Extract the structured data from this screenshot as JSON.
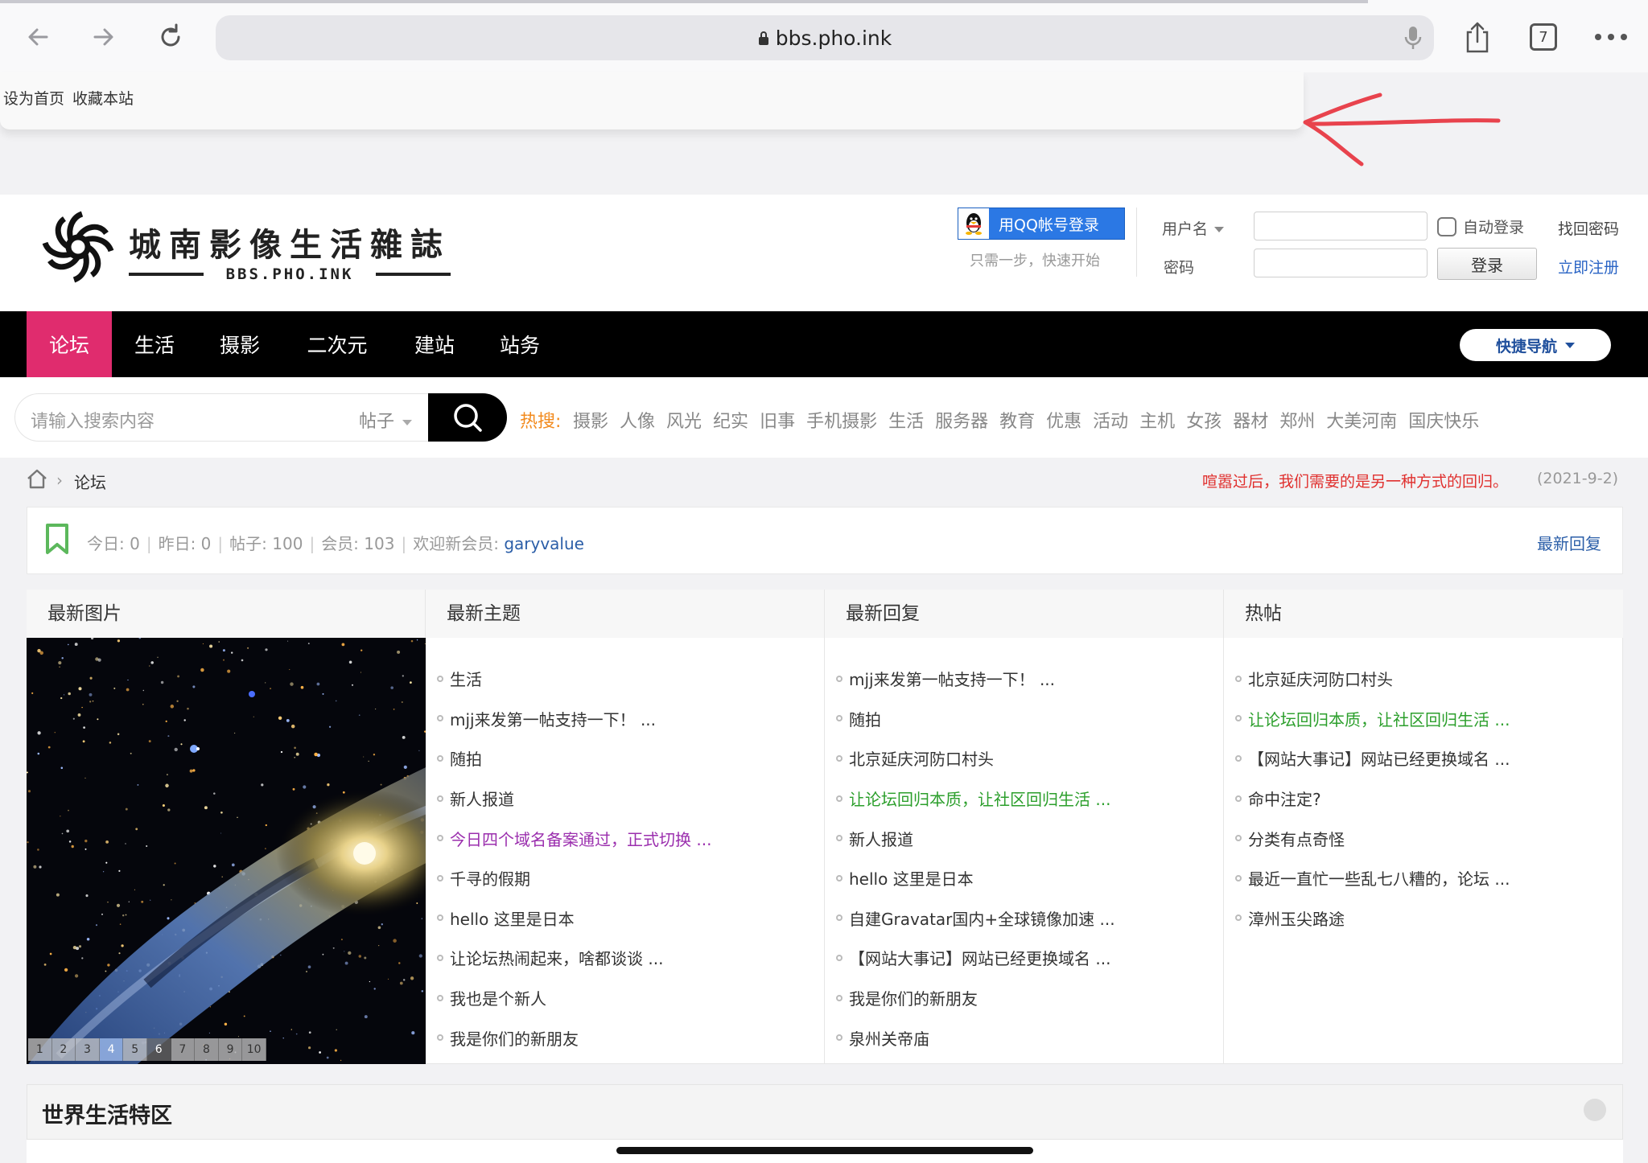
{
  "browser": {
    "url": "bbs.pho.ink",
    "tab_count": "7"
  },
  "topbar": {
    "set_home": "设为首页",
    "bookmark": "收藏本站"
  },
  "header": {
    "site_title": "城南影像生活雜誌",
    "site_sub": "BBS.PHO.INK",
    "qq_login": "用QQ帐号登录",
    "qq_tip": "只需一步，快速开始",
    "username_label": "用户名",
    "password_label": "密码",
    "auto_login": "自动登录",
    "find_password": "找回密码",
    "login_button": "登录",
    "register": "立即注册"
  },
  "nav": {
    "items": [
      "论坛",
      "生活",
      "摄影",
      "二次元",
      "建站",
      "站务"
    ],
    "quick_nav": "快捷导航"
  },
  "search": {
    "placeholder": "请输入搜索内容",
    "type": "帖子",
    "hot_label": "热搜:",
    "hot_terms": [
      "摄影",
      "人像",
      "风光",
      "纪实",
      "旧事",
      "手机摄影",
      "生活",
      "服务器",
      "教育",
      "优惠",
      "活动",
      "主机",
      "女孩",
      "器材",
      "郑州",
      "大美河南",
      "国庆快乐"
    ]
  },
  "breadcrumb": {
    "current": "论坛",
    "motto": "喧嚣过后，我们需要的是另一种方式的回归。",
    "date": "(2021-9-2)"
  },
  "stats": {
    "today": "今日: 0",
    "yesterday": "昨日: 0",
    "posts": "帖子: 100",
    "members": "会员: 103",
    "welcome": "欢迎新会员:",
    "new_member": "garyvalue",
    "latest_reply_link": "最新回复"
  },
  "columns": {
    "images": {
      "title": "最新图片",
      "pages": [
        "1",
        "2",
        "3",
        "4",
        "5",
        "6",
        "7",
        "8",
        "9",
        "10"
      ]
    },
    "topics": {
      "title": "最新主题",
      "items": [
        {
          "text": "生活",
          "color": ""
        },
        {
          "text": "mjj来发第一帖支持一下！ ...",
          "color": ""
        },
        {
          "text": "随拍",
          "color": ""
        },
        {
          "text": "新人报道",
          "color": ""
        },
        {
          "text": "今日四个域名备案通过，正式切换 ...",
          "color": "purple"
        },
        {
          "text": "千寻的假期",
          "color": ""
        },
        {
          "text": "hello 这里是日本",
          "color": ""
        },
        {
          "text": "让论坛热闹起来，啥都谈谈 ...",
          "color": ""
        },
        {
          "text": "我也是个新人",
          "color": ""
        },
        {
          "text": "我是你们的新朋友",
          "color": ""
        }
      ]
    },
    "replies": {
      "title": "最新回复",
      "items": [
        {
          "text": "mjj来发第一帖支持一下！ ...",
          "color": ""
        },
        {
          "text": "随拍",
          "color": ""
        },
        {
          "text": "北京延庆河防口村头",
          "color": ""
        },
        {
          "text": "让论坛回归本质，让社区回归生活 ...",
          "color": "green"
        },
        {
          "text": "新人报道",
          "color": ""
        },
        {
          "text": "hello 这里是日本",
          "color": ""
        },
        {
          "text": "自建Gravatar国内+全球镜像加速 ...",
          "color": ""
        },
        {
          "text": "【网站大事记】网站已经更换域名 ...",
          "color": ""
        },
        {
          "text": "我是你们的新朋友",
          "color": ""
        },
        {
          "text": "泉州关帝庙",
          "color": ""
        }
      ]
    },
    "hot": {
      "title": "热帖",
      "items": [
        {
          "text": "北京延庆河防口村头",
          "color": ""
        },
        {
          "text": "让论坛回归本质，让社区回归生活 ...",
          "color": "green"
        },
        {
          "text": "【网站大事记】网站已经更换域名 ...",
          "color": ""
        },
        {
          "text": "命中注定?",
          "color": ""
        },
        {
          "text": "分类有点奇怪",
          "color": ""
        },
        {
          "text": "最近一直忙一些乱七八糟的，论坛 ...",
          "color": ""
        },
        {
          "text": "漳州玉尖路途",
          "color": ""
        }
      ]
    }
  },
  "section": {
    "title": "世界生活特区"
  },
  "colors": {
    "nav_active": "#e02c6e",
    "hot_label": "#f28a1d",
    "link_blue": "#2b5ea8",
    "green_topic": "#2c9f2c",
    "purple_topic": "#9b2fae",
    "motto_red": "#e0302e"
  }
}
